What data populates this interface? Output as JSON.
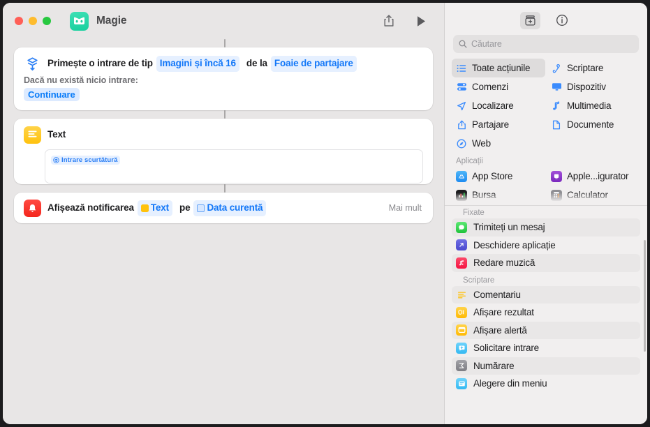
{
  "window": {
    "traffic_lights": [
      "close",
      "minimize",
      "zoom"
    ],
    "app_icon": "shortcuts-app-icon",
    "document_title": "Magie",
    "share_button": "share-icon",
    "run_button": "play-icon",
    "accent_blue": "#1277f8",
    "canvas_bg": "#e8e6e6",
    "sidebar_bg": "#f1efef"
  },
  "editor": {
    "actions": [
      {
        "icon": "receive-input-icon",
        "icon_color": "#2b7ff5",
        "title": "Primește o intrare de tip",
        "token1": "Imagini și încă 16",
        "mid": "de la",
        "token2": "Foaie de partajare",
        "sub_label": "Dacă nu există nicio intrare:",
        "sub_token": "Continuare"
      },
      {
        "icon": "text-action-icon",
        "icon_color": "#ffc20e",
        "title": "Text",
        "field_token": "Intrare scurtătură",
        "field_token_icon": "shortcut-input-icon"
      },
      {
        "icon": "notification-icon",
        "icon_color": "#f4261c",
        "title": "Afișează notificarea",
        "token1": "Text",
        "token1_icon": "text-variable-icon",
        "mid": "pe",
        "token2": "Data curentă",
        "token2_icon": "date-variable-icon",
        "more_label": "Mai mult"
      }
    ]
  },
  "library": {
    "tabs": [
      {
        "name": "action-library-tab",
        "icon": "action-library-icon",
        "active": true
      },
      {
        "name": "info-tab",
        "icon": "info-circle-icon",
        "active": false
      }
    ],
    "search": {
      "placeholder": "Căutare",
      "value": "",
      "icon": "search-icon"
    },
    "categories": [
      {
        "label": "Toate acțiunile",
        "icon": "list-bullet-icon",
        "selected": true
      },
      {
        "label": "Scriptare",
        "icon": "script-icon",
        "selected": false
      },
      {
        "label": "Comenzi",
        "icon": "controls-icon",
        "selected": false
      },
      {
        "label": "Dispozitiv",
        "icon": "display-icon",
        "selected": false
      },
      {
        "label": "Localizare",
        "icon": "location-arrow-icon",
        "selected": false
      },
      {
        "label": "Multimedia",
        "icon": "music-note-icon",
        "selected": false
      },
      {
        "label": "Partajare",
        "icon": "share-up-icon",
        "selected": false
      },
      {
        "label": "Documente",
        "icon": "document-icon",
        "selected": false
      },
      {
        "label": "Web",
        "icon": "compass-icon",
        "selected": false
      }
    ],
    "apps_header": "Aplicații",
    "apps": [
      {
        "label": "App Store",
        "icon": "app-store-icon",
        "color": "#2f9cf4"
      },
      {
        "label": "Apple...igurator",
        "icon": "apple-configurator-icon",
        "color": "#8b3fc4"
      },
      {
        "label": "Bursa",
        "icon": "stocks-icon",
        "color": "#1c1c1e"
      },
      {
        "label": "Calculator",
        "icon": "calculator-icon",
        "color": "#8e8e93"
      }
    ],
    "pinned_header": "Fixate",
    "pinned": [
      {
        "label": "Trimiteți un mesaj",
        "icon": "messages-icon",
        "color": "#2fc44a",
        "highlight": true
      },
      {
        "label": "Deschidere aplicație",
        "icon": "open-app-icon",
        "color": "#5856d6",
        "highlight": false
      },
      {
        "label": "Redare muzică",
        "icon": "music-play-icon",
        "color": "#fa2f55",
        "highlight": true
      }
    ],
    "scripting_header": "Scriptare",
    "scripting": [
      {
        "label": "Comentariu",
        "icon": "comment-icon",
        "color": "#ffffff",
        "highlight": true
      },
      {
        "label": "Afișare rezultat",
        "icon": "show-result-icon",
        "color": "#ffc20e",
        "highlight": false
      },
      {
        "label": "Afișare alertă",
        "icon": "show-alert-icon",
        "color": "#ffc20e",
        "highlight": true
      },
      {
        "label": "Solicitare intrare",
        "icon": "ask-input-icon",
        "color": "#4cc2f7",
        "highlight": false
      },
      {
        "label": "Numărare",
        "icon": "count-icon",
        "color": "#8e8e93",
        "highlight": true
      },
      {
        "label": "Alegere din meniu",
        "icon": "choose-menu-icon",
        "color": "#4cc2f7",
        "highlight": false
      }
    ]
  }
}
